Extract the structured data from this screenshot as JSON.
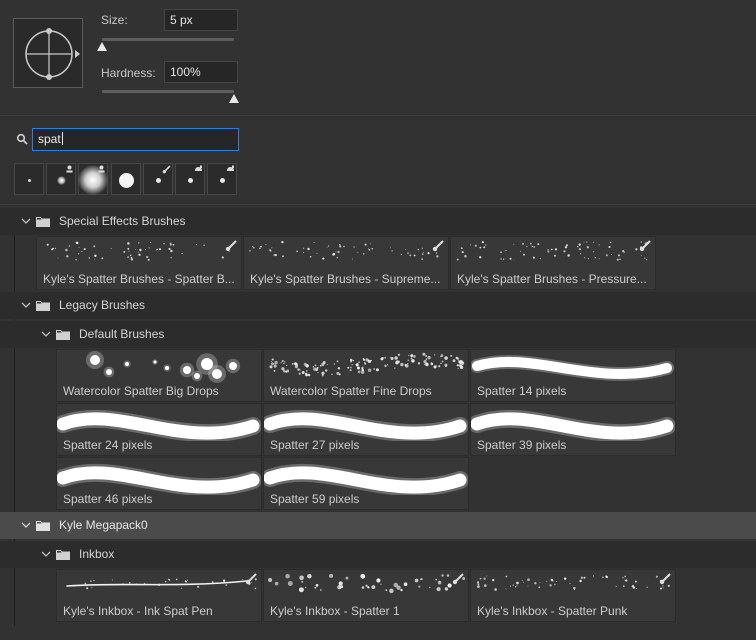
{
  "brush_settings": {
    "size_label": "Size:",
    "size_value": "5 px",
    "size_fraction": 0.0,
    "hardness_label": "Hardness:",
    "hardness_value": "100%",
    "hardness_fraction": 1.0
  },
  "search": {
    "value": "spat"
  },
  "recent_brushes": [
    {
      "kind": "tiny-hard"
    },
    {
      "kind": "small-soft",
      "badge": "pressure"
    },
    {
      "kind": "large-soft",
      "badge": "pressure"
    },
    {
      "kind": "large-hard"
    },
    {
      "kind": "small-hard",
      "badge": "brush"
    },
    {
      "kind": "small-hard",
      "badge": "airbrush"
    },
    {
      "kind": "small-hard",
      "badge": "airbrush"
    }
  ],
  "groups": {
    "special_effects": {
      "label": "Special Effects Brushes",
      "brushes": [
        {
          "name": "Kyle's Spatter Brushes - Spatter B..."
        },
        {
          "name": "Kyle's Spatter Brushes - Supreme..."
        },
        {
          "name": "Kyle's Spatter Brushes - Pressure..."
        }
      ]
    },
    "legacy": {
      "label": "Legacy Brushes",
      "default_brushes": {
        "label": "Default Brushes",
        "brushes": [
          {
            "name": "Watercolor Spatter Big Drops"
          },
          {
            "name": "Watercolor Spatter Fine Drops"
          },
          {
            "name": "Spatter 14 pixels"
          },
          {
            "name": "Spatter 24 pixels"
          },
          {
            "name": "Spatter 27 pixels"
          },
          {
            "name": "Spatter 39 pixels"
          },
          {
            "name": "Spatter 46 pixels"
          },
          {
            "name": "Spatter 59 pixels"
          }
        ]
      }
    },
    "kyle_megapack": {
      "label": "Kyle Megapack0",
      "inkbox": {
        "label": "Inkbox",
        "brushes": [
          {
            "name": "Kyle's Inkbox - Ink Spat Pen"
          },
          {
            "name": "Kyle's Inkbox - Spatter 1"
          },
          {
            "name": "Kyle's Inkbox - Spatter Punk"
          }
        ]
      }
    }
  },
  "colors": {
    "panel": "#323232",
    "tile": "#383838",
    "selected_row": "#4b4b4b",
    "focus": "#2f7fd3"
  }
}
